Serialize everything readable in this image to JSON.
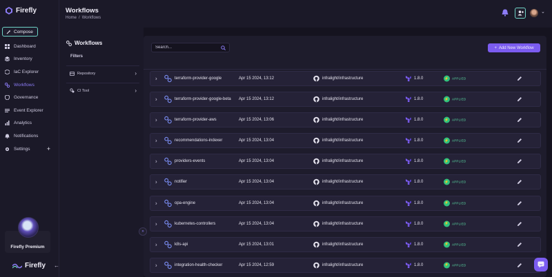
{
  "app": {
    "name": "Firefly",
    "premium_label": "Firefly Premium"
  },
  "sidebar": {
    "compose_label": "Compose",
    "items": [
      {
        "label": "Dashboard",
        "icon": "dashboard-icon"
      },
      {
        "label": "Inventory",
        "icon": "layers-icon"
      },
      {
        "label": "IaC Explorer",
        "icon": "code-icon"
      },
      {
        "label": "Workflows",
        "icon": "workflow-icon",
        "active": true
      },
      {
        "label": "Governance",
        "icon": "shield-icon"
      },
      {
        "label": "Event Explorer",
        "icon": "list-icon"
      },
      {
        "label": "Analytics",
        "icon": "chart-icon"
      },
      {
        "label": "Notifications",
        "icon": "bell-icon"
      },
      {
        "label": "Settings",
        "icon": "gear-icon"
      }
    ]
  },
  "header": {
    "title": "Workflows",
    "breadcrumb": [
      "Home",
      "Workflows"
    ],
    "breadcrumb_sep": "/"
  },
  "filters": {
    "title": "Workflows",
    "subtitle": "Filters",
    "groups": [
      "Repository",
      "CI Tool"
    ]
  },
  "toolbar": {
    "search_placeholder": "Search...",
    "add_label": "Add New Workflow"
  },
  "colors": {
    "accent": "#7b5cf0",
    "applied": "#2ec27e",
    "compose_border": "#6fd3c6"
  },
  "workflows": [
    {
      "name": "terraform-provider-google",
      "date": "Apr 15 2024, 13:12",
      "repo": "infralight/infrastructure",
      "version": "1.8.0",
      "status": "APPLIED"
    },
    {
      "name": "terraform-provider-google-beta",
      "date": "Apr 15 2024, 13:12",
      "repo": "infralight/infrastructure",
      "version": "1.8.0",
      "status": "APPLIED"
    },
    {
      "name": "terraform-provider-aws",
      "date": "Apr 15 2024, 13:06",
      "repo": "infralight/infrastructure",
      "version": "1.8.0",
      "status": "APPLIED"
    },
    {
      "name": "recommendations-indexer",
      "date": "Apr 15 2024, 13:04",
      "repo": "infralight/infrastructure",
      "version": "1.8.0",
      "status": "APPLIED"
    },
    {
      "name": "providers-events",
      "date": "Apr 15 2024, 13:04",
      "repo": "infralight/infrastructure",
      "version": "1.8.0",
      "status": "APPLIED"
    },
    {
      "name": "notifier",
      "date": "Apr 15 2024, 13:04",
      "repo": "infralight/infrastructure",
      "version": "1.8.0",
      "status": "APPLIED"
    },
    {
      "name": "opa-engine",
      "date": "Apr 15 2024, 13:04",
      "repo": "infralight/infrastructure",
      "version": "1.8.0",
      "status": "APPLIED"
    },
    {
      "name": "kubernetes-controllers",
      "date": "Apr 15 2024, 13:04",
      "repo": "infralight/infrastructure",
      "version": "1.8.0",
      "status": "APPLIED"
    },
    {
      "name": "k8s-api",
      "date": "Apr 15 2024, 13:01",
      "repo": "infralight/infrastructure",
      "version": "1.8.0",
      "status": "APPLIED"
    },
    {
      "name": "integration-health-checker",
      "date": "Apr 15 2024, 12:59",
      "repo": "infralight/infrastructure",
      "version": "1.8.0",
      "status": "APPLIED"
    }
  ]
}
